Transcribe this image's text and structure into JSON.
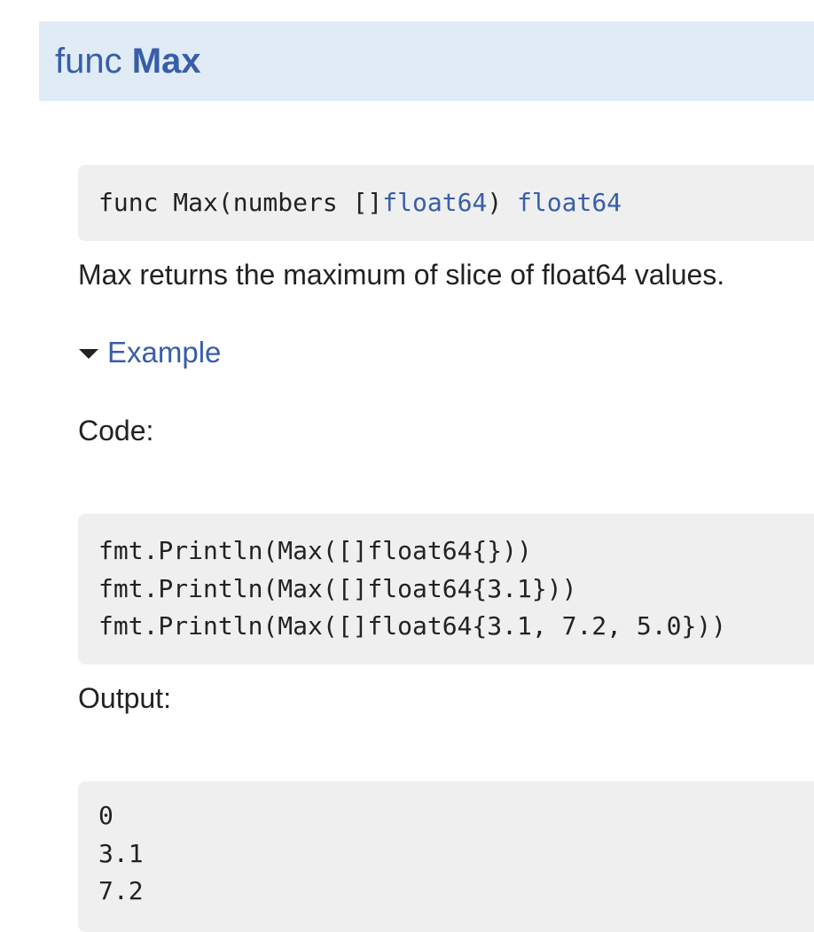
{
  "header": {
    "prefix": "func",
    "name": "Max"
  },
  "signature": {
    "prefix": "func Max(numbers []",
    "param_type": "float64",
    "middle": ") ",
    "return_type": "float64"
  },
  "description": "Max returns the maximum of slice of float64 values.",
  "example": {
    "toggle_label": "Example",
    "expanded": true,
    "code_label": "Code:",
    "code_lines": [
      "fmt.Println(Max([]float64{}))",
      "fmt.Println(Max([]float64{3.1}))",
      "fmt.Println(Max([]float64{3.1, 7.2, 5.0}))"
    ],
    "output_label": "Output:",
    "output_lines": [
      "0",
      "3.1",
      "7.2"
    ]
  },
  "colors": {
    "link": "#375eab",
    "header_bg": "#e0ebf5",
    "code_bg": "#efefef",
    "text": "#222222"
  }
}
